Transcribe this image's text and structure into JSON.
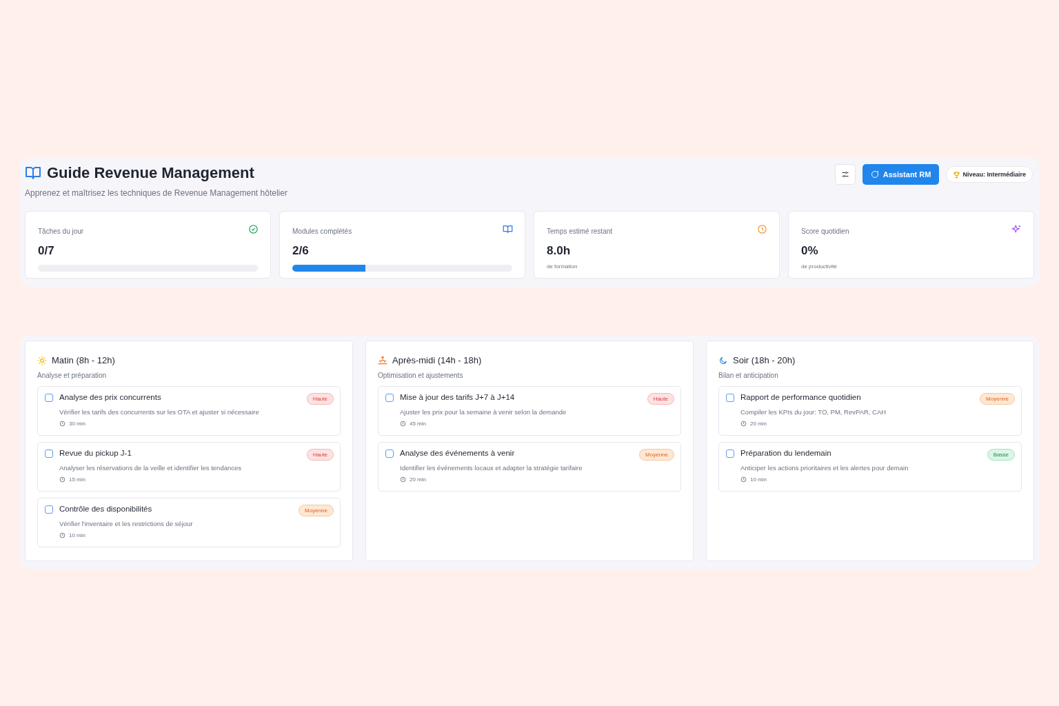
{
  "header": {
    "title": "Guide Revenue Management",
    "subtitle": "Apprenez et maîtrisez les techniques de Revenue Management hôtelier",
    "assistant_button": "Assistant RM",
    "level_badge": "Niveau: Intermédiaire"
  },
  "stats": [
    {
      "label": "Tâches du jour",
      "value": "0/7",
      "level": 0
    },
    {
      "label": "Modules complétés",
      "value": "2/6",
      "level": 0.333
    },
    {
      "label": "Temps estimé restant",
      "value": "8.0h",
      "note": "de formation"
    },
    {
      "label": "Score quotidien",
      "value": "0%",
      "note": "de productivité"
    }
  ],
  "periods": [
    {
      "title": "Matin (8h - 12h)",
      "subtitle": "Analyse et préparation",
      "tasks": [
        {
          "title": "Analyse des prix concurrents",
          "description": "Vérifier les tarifs des concurrents sur les OTA et ajuster si nécessaire",
          "duration": "30 min",
          "priority": "Haute",
          "kind": "high",
          "checked": false
        },
        {
          "title": "Revue du pickup J-1",
          "description": "Analyser les réservations de la veille et identifier les tendances",
          "duration": "15 min",
          "priority": "Haute",
          "kind": "high",
          "checked": false
        },
        {
          "title": "Contrôle des disponibilités",
          "description": "Vérifier l'inventaire et les restrictions de séjour",
          "duration": "10 min",
          "priority": "Moyenne",
          "kind": "medium",
          "checked": false
        }
      ]
    },
    {
      "title": "Après-midi (14h - 18h)",
      "subtitle": "Optimisation et ajustements",
      "tasks": [
        {
          "title": "Mise à jour des tarifs J+7 à J+14",
          "description": "Ajuster les prix pour la semaine à venir selon la demande",
          "duration": "45 min",
          "priority": "Haute",
          "kind": "high",
          "checked": false
        },
        {
          "title": "Analyse des événements à venir",
          "description": "Identifier les événements locaux et adapter la stratégie tarifaire",
          "duration": "20 min",
          "priority": "Moyenne",
          "kind": "medium",
          "checked": false
        }
      ]
    },
    {
      "title": "Soir (18h - 20h)",
      "subtitle": "Bilan et anticipation",
      "tasks": [
        {
          "title": "Rapport de performance quotidien",
          "description": "Compiler les KPIs du jour: TO, PM, RevPAR, CAH",
          "duration": "20 min",
          "priority": "Moyenne",
          "kind": "medium",
          "checked": false
        },
        {
          "title": "Préparation du lendemain",
          "description": "Anticiper les actions prioritaires et les alertes pour demain",
          "duration": "10 min",
          "priority": "Basse",
          "kind": "low",
          "checked": false
        }
      ]
    }
  ]
}
